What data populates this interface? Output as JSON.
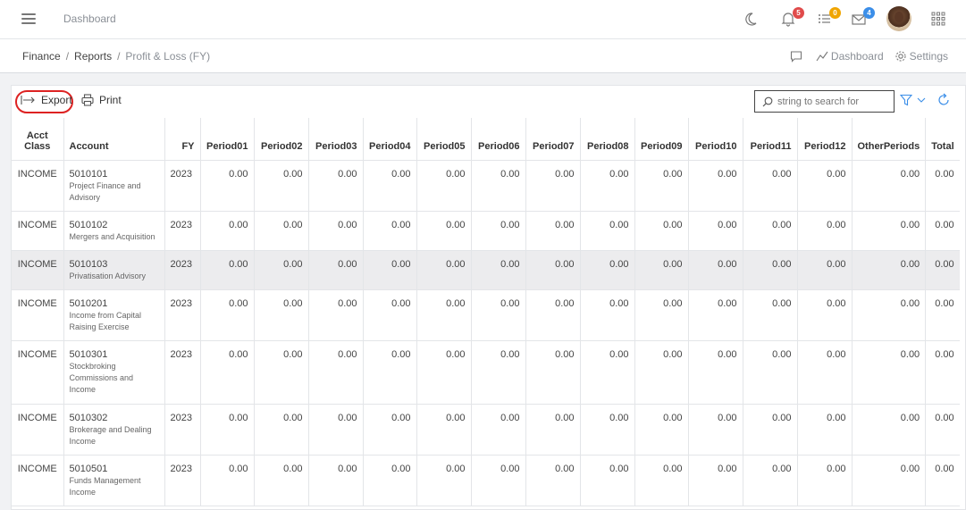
{
  "topbar": {
    "title": "Dashboard",
    "notifications_count": "5",
    "tasks_count": "0",
    "messages_count": "4",
    "colors": {
      "notif": "#e04b4b",
      "tasks": "#f0a500",
      "messages": "#3b8ee8"
    }
  },
  "breadcrumb": {
    "items": [
      "Finance",
      "Reports",
      "Profit & Loss (FY)"
    ],
    "actions": {
      "dashboard": "Dashboard",
      "settings": "Settings"
    }
  },
  "toolbar": {
    "export_label": "Export",
    "print_label": "Print",
    "search_placeholder": "string to search for"
  },
  "table": {
    "columns": [
      "Acct Class",
      "Account",
      "FY",
      "Period01",
      "Period02",
      "Period03",
      "Period04",
      "Period05",
      "Period06",
      "Period07",
      "Period08",
      "Period09",
      "Period10",
      "Period11",
      "Period12",
      "OtherPeriods",
      "Total"
    ],
    "rows": [
      {
        "class": "INCOME",
        "code": "5010101",
        "name": "Project Finance and Advisory",
        "fy": "2023",
        "values": [
          "0.00",
          "0.00",
          "0.00",
          "0.00",
          "0.00",
          "0.00",
          "0.00",
          "0.00",
          "0.00",
          "0.00",
          "0.00",
          "0.00",
          "0.00",
          "0.00"
        ]
      },
      {
        "class": "INCOME",
        "code": "5010102",
        "name": "Mergers and Acquisition",
        "fy": "2023",
        "values": [
          "0.00",
          "0.00",
          "0.00",
          "0.00",
          "0.00",
          "0.00",
          "0.00",
          "0.00",
          "0.00",
          "0.00",
          "0.00",
          "0.00",
          "0.00",
          "0.00"
        ]
      },
      {
        "class": "INCOME",
        "code": "5010103",
        "name": "Privatisation Advisory",
        "fy": "2023",
        "values": [
          "0.00",
          "0.00",
          "0.00",
          "0.00",
          "0.00",
          "0.00",
          "0.00",
          "0.00",
          "0.00",
          "0.00",
          "0.00",
          "0.00",
          "0.00",
          "0.00"
        ]
      },
      {
        "class": "INCOME",
        "code": "5010201",
        "name": "Income from Capital Raising Exercise",
        "fy": "2023",
        "values": [
          "0.00",
          "0.00",
          "0.00",
          "0.00",
          "0.00",
          "0.00",
          "0.00",
          "0.00",
          "0.00",
          "0.00",
          "0.00",
          "0.00",
          "0.00",
          "0.00"
        ]
      },
      {
        "class": "INCOME",
        "code": "5010301",
        "name": "Stockbroking Commissions and Income",
        "fy": "2023",
        "values": [
          "0.00",
          "0.00",
          "0.00",
          "0.00",
          "0.00",
          "0.00",
          "0.00",
          "0.00",
          "0.00",
          "0.00",
          "0.00",
          "0.00",
          "0.00",
          "0.00"
        ]
      },
      {
        "class": "INCOME",
        "code": "5010302",
        "name": "Brokerage and Dealing Income",
        "fy": "2023",
        "values": [
          "0.00",
          "0.00",
          "0.00",
          "0.00",
          "0.00",
          "0.00",
          "0.00",
          "0.00",
          "0.00",
          "0.00",
          "0.00",
          "0.00",
          "0.00",
          "0.00"
        ]
      },
      {
        "class": "INCOME",
        "code": "5010501",
        "name": "Funds Management Income",
        "fy": "2023",
        "values": [
          "0.00",
          "0.00",
          "0.00",
          "0.00",
          "0.00",
          "0.00",
          "0.00",
          "0.00",
          "0.00",
          "0.00",
          "0.00",
          "0.00",
          "0.00",
          "0.00"
        ]
      }
    ]
  }
}
